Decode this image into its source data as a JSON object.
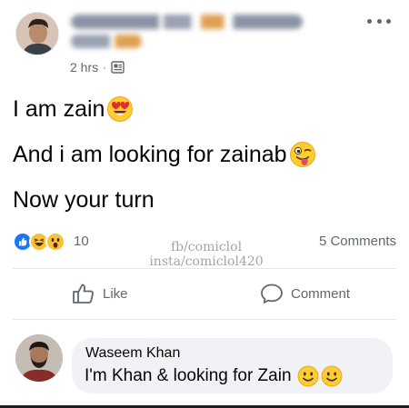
{
  "post": {
    "time": "2 hrs",
    "separator": "·",
    "privacy_icon": "public-page-icon",
    "lines": [
      {
        "text": "I am zain",
        "emoji": "heart-eyes-emoji"
      },
      {
        "text": "And i am looking for zainab",
        "emoji": "winking-tongue-emoji"
      },
      {
        "text": "Now your turn",
        "emoji": ""
      }
    ]
  },
  "reactions": {
    "icons": [
      "like-reaction-icon",
      "haha-reaction-icon",
      "wow-reaction-icon"
    ],
    "count": "10",
    "comments": "5 Comments"
  },
  "watermark": {
    "line1": "fb/comiclol",
    "line2": "insta/comiclol420"
  },
  "actions": {
    "like_label": "Like",
    "comment_label": "Comment"
  },
  "comment": {
    "author": "Waseem Khan",
    "text": "I'm Khan & looking for Zain",
    "emojis": [
      "smiling-emoji",
      "smiling-emoji"
    ]
  },
  "colors": {
    "text": "#050505",
    "secondary": "#606770",
    "like_blue": "#1877f2",
    "bubble": "#f0f2f5",
    "divider": "#e4e6eb"
  }
}
